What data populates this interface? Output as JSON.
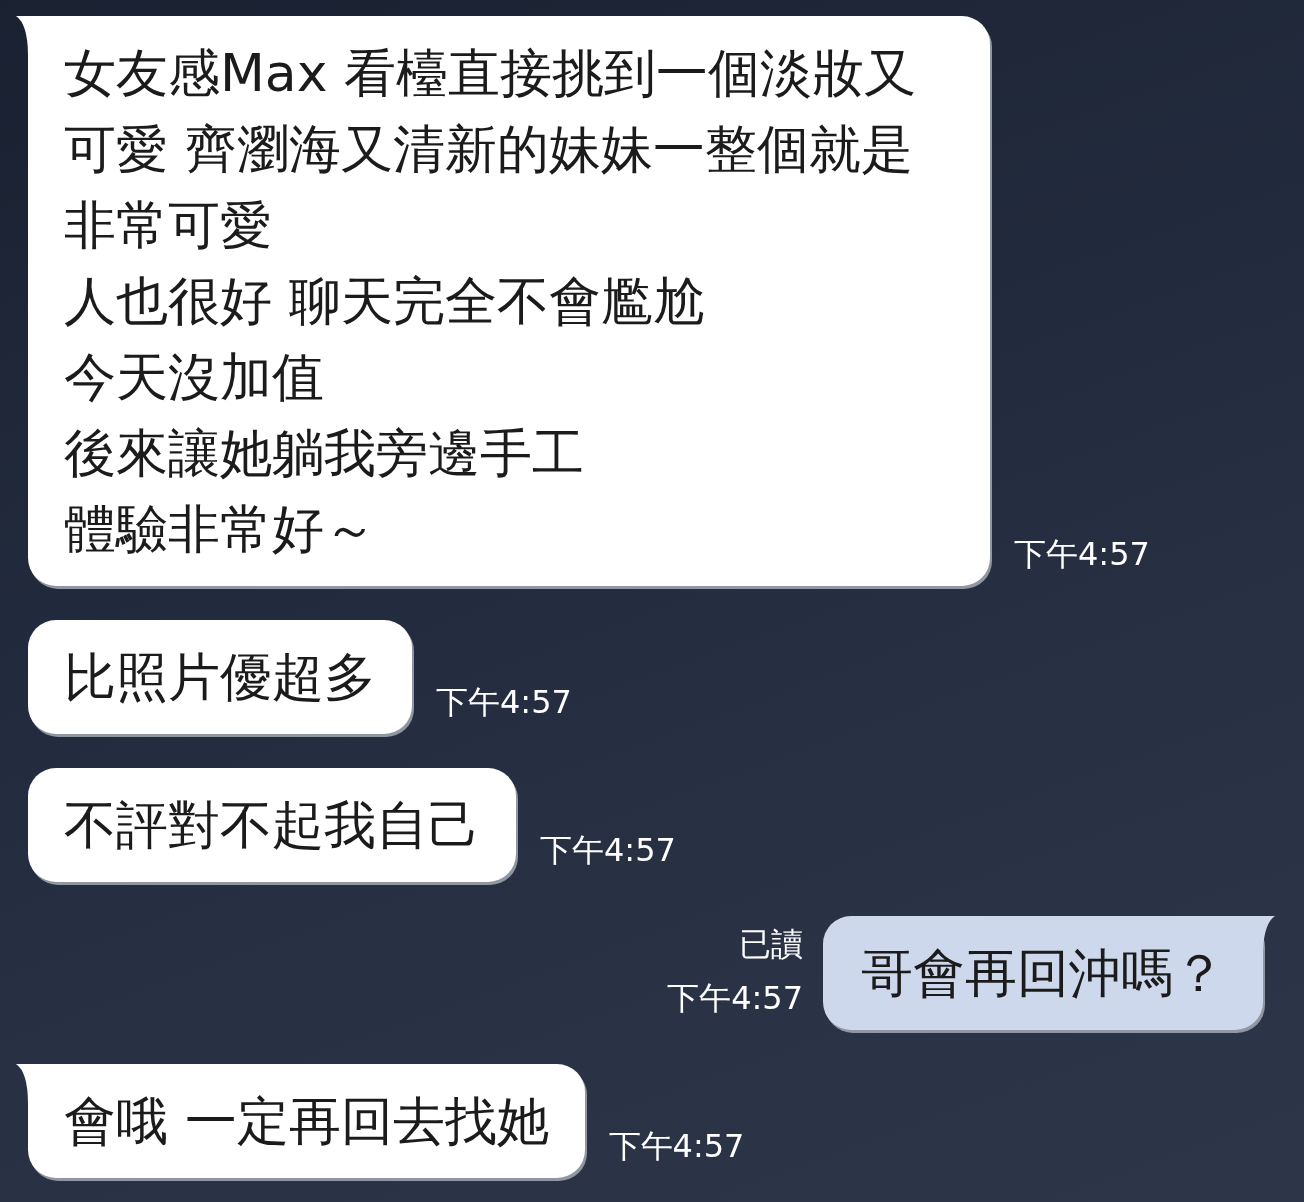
{
  "messages": [
    {
      "kind": "incoming",
      "tail": true,
      "paragraphs": [
        "女友感Max 看檯直接挑到一個淡妝又可愛 齊瀏海又清新的妹妹一整個就是非常可愛",
        "人也很好 聊天完全不會尷尬",
        "今天沒加值",
        "後來讓她躺我旁邊手工",
        "體驗非常好～"
      ],
      "time": "下午4:57"
    },
    {
      "kind": "incoming",
      "tail": false,
      "paragraphs": [
        "比照片優超多"
      ],
      "time": "下午4:57"
    },
    {
      "kind": "incoming",
      "tail": false,
      "paragraphs": [
        "不評對不起我自己"
      ],
      "time": "下午4:57"
    },
    {
      "kind": "outgoing",
      "tail": true,
      "paragraphs": [
        "哥會再回沖嗎？"
      ],
      "read_receipt": "已讀",
      "time": "下午4:57"
    },
    {
      "kind": "incoming",
      "tail": true,
      "paragraphs": [
        "會哦 一定再回去找她"
      ],
      "time": "下午4:57"
    }
  ]
}
